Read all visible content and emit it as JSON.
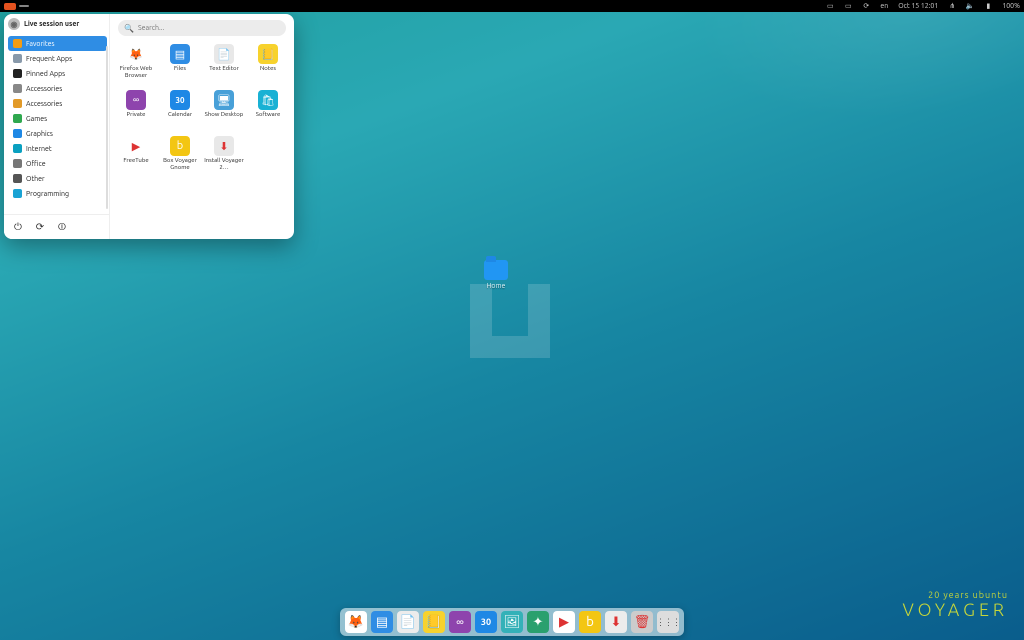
{
  "topbar": {
    "datetime": "Oct 15  12:01",
    "lang": "en",
    "battery": "100%"
  },
  "user": {
    "name": "Live session user"
  },
  "search": {
    "placeholder": "Search..."
  },
  "categories": [
    {
      "label": "Favorites",
      "active": true,
      "color": "#f39c12"
    },
    {
      "label": "Frequent Apps",
      "active": false,
      "color": "#8899aa"
    },
    {
      "label": "Pinned Apps",
      "active": false,
      "color": "#222222"
    },
    {
      "label": "Accessories",
      "active": false,
      "color": "#888888"
    },
    {
      "label": "Accessories",
      "active": false,
      "color": "#e29a28"
    },
    {
      "label": "Games",
      "active": false,
      "color": "#2fa84f"
    },
    {
      "label": "Graphics",
      "active": false,
      "color": "#1e88e5"
    },
    {
      "label": "Internet",
      "active": false,
      "color": "#0aa0c0"
    },
    {
      "label": "Office",
      "active": false,
      "color": "#777777"
    },
    {
      "label": "Other",
      "active": false,
      "color": "#555555"
    },
    {
      "label": "Programming",
      "active": false,
      "color": "#1aa3d4"
    }
  ],
  "apps": [
    {
      "label": "Firefox Web Browser",
      "icon": "firefox",
      "bg": "#ffffff",
      "glyph": "🦊"
    },
    {
      "label": "Files",
      "icon": "files",
      "bg": "#2f8de4",
      "glyph": "▤"
    },
    {
      "label": "Text Editor",
      "icon": "textedit",
      "bg": "#e8e8e8",
      "glyph": "📄"
    },
    {
      "label": "Notes",
      "icon": "notes",
      "bg": "#f7d22d",
      "glyph": "📒"
    },
    {
      "label": "Private",
      "icon": "private",
      "bg": "#8e44ad",
      "glyph": "∞"
    },
    {
      "label": "Calendar",
      "icon": "calendar",
      "bg": "#1e88e5",
      "glyph": "30"
    },
    {
      "label": "Show Desktop",
      "icon": "showdesk",
      "bg": "#48a0d8",
      "glyph": "🖥"
    },
    {
      "label": "Software",
      "icon": "software",
      "bg": "#19b1d4",
      "glyph": "🛍"
    },
    {
      "label": "FreeTube",
      "icon": "freetube",
      "bg": "#ffffff",
      "glyph": "▶"
    },
    {
      "label": "Box Voyager Gnome",
      "icon": "boxvoy",
      "bg": "#f3c613",
      "glyph": "b"
    },
    {
      "label": "Install Voyager 2…",
      "icon": "install",
      "bg": "#e8e8e8",
      "glyph": "⬇"
    }
  ],
  "desktop": {
    "home_label": "Home"
  },
  "dock": [
    {
      "name": "firefox",
      "bg": "#ffffff",
      "glyph": "🦊"
    },
    {
      "name": "files",
      "bg": "#2f8de4",
      "glyph": "▤"
    },
    {
      "name": "textedit",
      "bg": "#ececec",
      "glyph": "📄"
    },
    {
      "name": "notes",
      "bg": "#f7d22d",
      "glyph": "📒"
    },
    {
      "name": "private",
      "bg": "#8e44ad",
      "glyph": "∞"
    },
    {
      "name": "calendar",
      "bg": "#1e88e5",
      "glyph": "30"
    },
    {
      "name": "wall",
      "bg": "#34b1b8",
      "glyph": "🖼"
    },
    {
      "name": "tweak",
      "bg": "#2aa06e",
      "glyph": "✦"
    },
    {
      "name": "freetube",
      "bg": "#ffffff",
      "glyph": "▶"
    },
    {
      "name": "boxvoy",
      "bg": "#f3c613",
      "glyph": "b"
    },
    {
      "name": "install",
      "bg": "#ececec",
      "glyph": "⬇"
    },
    {
      "name": "trash",
      "bg": "#cccccc",
      "glyph": "🗑"
    },
    {
      "name": "apps",
      "bg": "#dddddd",
      "glyph": "⋮⋮⋮"
    }
  ],
  "brand": {
    "sub": "20 years ubuntu",
    "main": "VOYAGER"
  }
}
